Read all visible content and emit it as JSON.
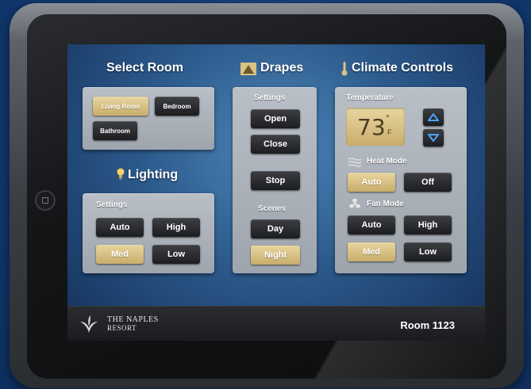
{
  "select_room": {
    "title": "Select Room",
    "rooms": [
      "Living Room",
      "Bedroom",
      "Bathroom"
    ],
    "active_room": "Living Room"
  },
  "lighting": {
    "title": "Lighting",
    "settings_label": "Settings",
    "buttons": [
      "Auto",
      "High",
      "Med",
      "Low"
    ],
    "active": "Med"
  },
  "drapes": {
    "title": "Drapes",
    "settings_label": "Settings",
    "buttons": [
      "Open",
      "Close",
      "Stop"
    ],
    "scenes_label": "Scenes",
    "scenes": [
      "Day",
      "Night"
    ],
    "active_scene": "Night"
  },
  "climate": {
    "title": "Climate Controls",
    "temperature_label": "Temperature",
    "temperature": "73",
    "degree_symbol": "°",
    "unit": "F",
    "heat_mode_label": "Heat Mode",
    "heat_buttons": [
      "Auto",
      "Off"
    ],
    "heat_active": "Auto",
    "fan_mode_label": "Fan Mode",
    "fan_buttons": [
      "Auto",
      "High",
      "Med",
      "Low"
    ],
    "fan_active": "Med"
  },
  "footer": {
    "brand_line1": "The Naples",
    "brand_line2": "Resort",
    "room": "Room 1123"
  },
  "colors": {
    "active_gold": "#d9c283",
    "button_dark": "#2a2c30",
    "panel_grey": "#a9b0b8"
  }
}
